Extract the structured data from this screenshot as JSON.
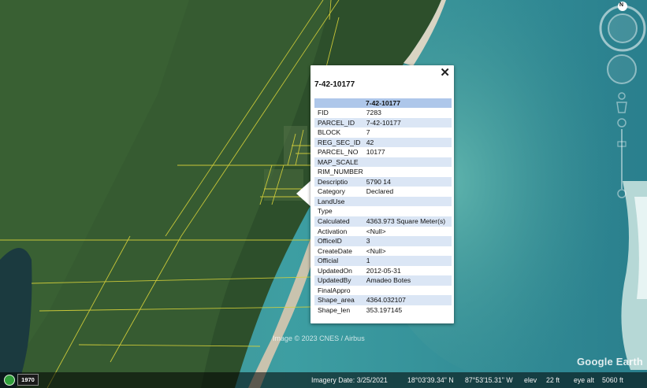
{
  "map": {
    "copyright": "Image © 2023 CNES / Airbus",
    "logo": "Google Earth"
  },
  "popup": {
    "title": "7-42-10177",
    "close_icon": "close-icon",
    "table_header": "7-42-10177",
    "rows": [
      {
        "key": "FID",
        "value": "7283"
      },
      {
        "key": "PARCEL_ID",
        "value": "7-42-10177"
      },
      {
        "key": "BLOCK",
        "value": "7"
      },
      {
        "key": "REG_SEC_ID",
        "value": "42"
      },
      {
        "key": "PARCEL_NO",
        "value": "10177"
      },
      {
        "key": "MAP_SCALE",
        "value": ""
      },
      {
        "key": "RIM_NUMBER",
        "value": ""
      },
      {
        "key": "Descriptio",
        "value": "5790 14"
      },
      {
        "key": "Category",
        "value": "Declared"
      },
      {
        "key": "LandUse",
        "value": ""
      },
      {
        "key": "Type",
        "value": ""
      },
      {
        "key": "Calculated",
        "value": "4363.973 Square Meter(s)"
      },
      {
        "key": "Activation",
        "value": "<Null>"
      },
      {
        "key": "OfficeID",
        "value": "3"
      },
      {
        "key": "CreateDate",
        "value": "<Null>"
      },
      {
        "key": "Official",
        "value": "1"
      },
      {
        "key": "UpdatedOn",
        "value": "2012-05-31"
      },
      {
        "key": "UpdatedBy",
        "value": "Amadeo Botes"
      },
      {
        "key": "FinalAppro",
        "value": ""
      },
      {
        "key": "Shape_area",
        "value": "4364.032107"
      },
      {
        "key": "Shape_len",
        "value": "353.197145"
      }
    ]
  },
  "status": {
    "year": "1970",
    "imagery_date": "Imagery Date: 3/25/2021",
    "lat": "18°03'39.34\" N",
    "lon": "87°53'15.31\" W",
    "elev_label": "elev",
    "elev_value": "22 ft",
    "eye_alt_label": "eye alt",
    "eye_alt_value": "5060 ft"
  },
  "nav": {
    "north": "N",
    "compass_icon": "compass-icon",
    "look_icon": "look-joystick-icon",
    "street_view_icon": "pegman-icon",
    "zoom_slider": "zoom-slider-icon"
  }
}
